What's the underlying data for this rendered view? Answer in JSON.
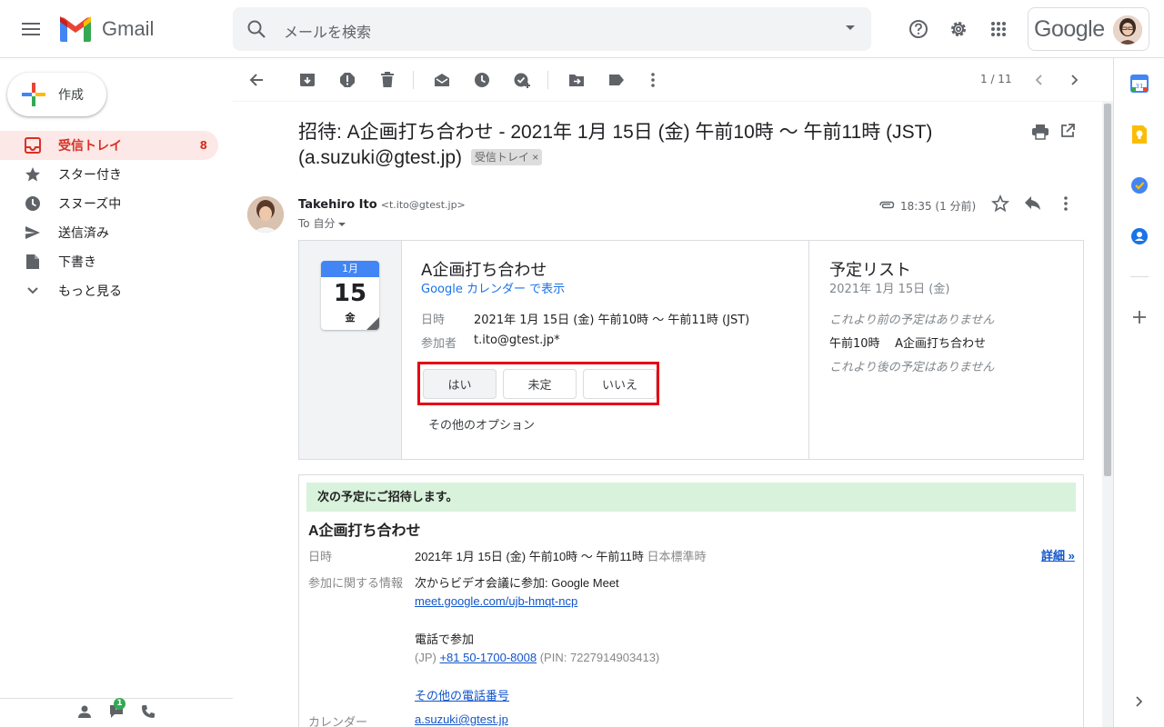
{
  "app": {
    "name": "Gmail"
  },
  "search": {
    "placeholder": "メールを検索"
  },
  "account": {
    "word": "Google"
  },
  "compose": {
    "label": "作成"
  },
  "nav": [
    {
      "label": "受信トレイ",
      "count": "8",
      "icon": "inbox-icon"
    },
    {
      "label": "スター付き",
      "count": "",
      "icon": "star-icon"
    },
    {
      "label": "スヌーズ中",
      "count": "",
      "icon": "clock-icon"
    },
    {
      "label": "送信済み",
      "count": "",
      "icon": "send-icon"
    },
    {
      "label": "下書き",
      "count": "",
      "icon": "draft-icon"
    },
    {
      "label": "もっと見る",
      "count": "",
      "icon": "chevron-down-icon"
    }
  ],
  "chat_badge": "1",
  "pager": "1 / 11",
  "message": {
    "subject": "招待: A企画打ち合わせ - 2021年 1月 15日 (金) 午前10時 〜 午前11時 (JST) (a.suzuki@gtest.jp)",
    "label_chip": "受信トレイ",
    "sender_name": "Takehiro Ito",
    "sender_email": "<t.ito@gtest.jp>",
    "to": "To 自分",
    "time": "18:35 (1 分前)"
  },
  "invite": {
    "month": "1月",
    "day": "15",
    "weekday": "金",
    "title": "A企画打ち合わせ",
    "calendar_link": "Google カレンダー で表示",
    "when_label": "日時",
    "when_value": "2021年 1月 15日 (金) 午前10時 〜 午前11時 (JST)",
    "guests_label": "参加者",
    "guests_value": "t.ito@gtest.jp*",
    "rsvp": {
      "yes": "はい",
      "maybe": "未定",
      "no": "いいえ"
    },
    "more_options": "その他のオプション"
  },
  "agenda": {
    "title": "予定リスト",
    "date": "2021年 1月 15日 (金)",
    "before": "これより前の予定はありません",
    "event_time": "午前10時",
    "event_title": "A企画打ち合わせ",
    "after": "これより後の予定はありません"
  },
  "body": {
    "banner": "次の予定にご招待します。",
    "title": "A企画打ち合わせ",
    "when_label": "日時",
    "when_value": "2021年 1月 15日 (金) 午前10時 〜 午前11時",
    "timezone": "日本標準時",
    "details_link": "詳細 »",
    "join_label": "参加に関する情報",
    "meet_text": "次からビデオ会議に参加: Google Meet",
    "meet_link": "meet.google.com/ujb-hmqt-ncp",
    "phone_title": "電話で参加",
    "phone_country": "(JP)",
    "phone_number": "+81 50-1700-8008",
    "phone_pin": "(PIN: 7227914903413)",
    "other_numbers": "その他の電話番号",
    "calendar_label": "カレンダー",
    "calendar_value": "a.suzuki@gtest.jp"
  },
  "colors": {
    "accent_red": "#d93025",
    "highlight_box": "#e50012",
    "banner_green": "#d9f2dc",
    "link_blue": "#1a73e8"
  }
}
